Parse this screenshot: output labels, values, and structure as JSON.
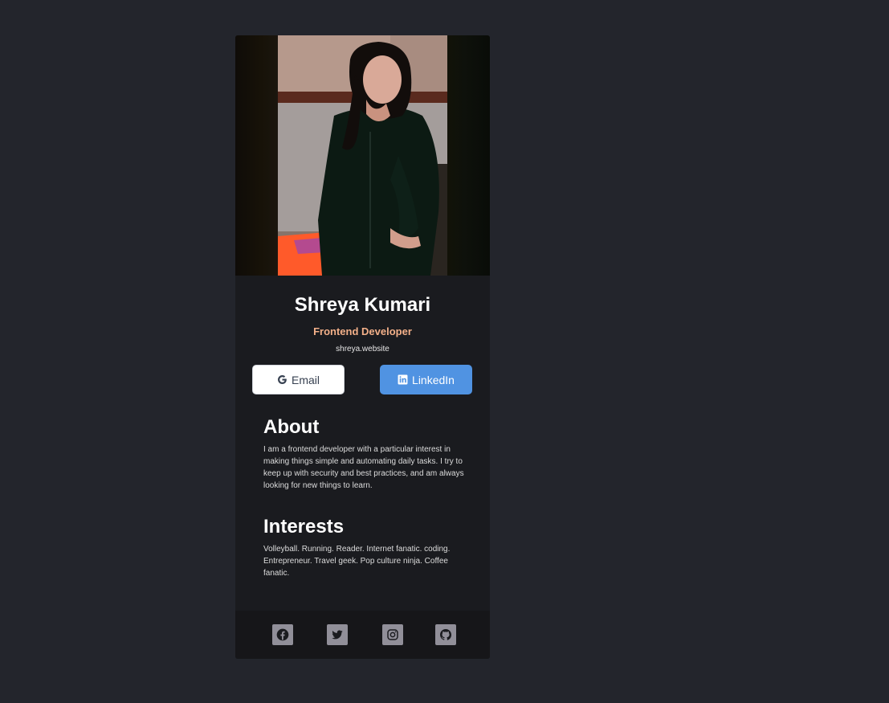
{
  "profile": {
    "name": "Shreya Kumari",
    "role": "Frontend Developer",
    "website": "shreya.website"
  },
  "buttons": {
    "email_label": "Email",
    "linkedin_label": "LinkedIn"
  },
  "about": {
    "title": "About",
    "text": "I am a frontend developer with a particular interest in making things simple and automating daily tasks. I try to keep up with security and best practices, and am always looking for new things to learn."
  },
  "interests": {
    "title": "Interests",
    "text": "Volleyball. Running. Reader. Internet fanatic. coding. Entrepreneur. Travel geek. Pop culture ninja. Coffee fanatic."
  },
  "social_icons": [
    "facebook-icon",
    "twitter-icon",
    "instagram-icon",
    "github-icon"
  ],
  "colors": {
    "page_background": "#23252c",
    "card_background": "#1a1b1f",
    "footer_background": "#161619",
    "role_accent": "#f3b089",
    "linkedin_button": "#5093e2",
    "social_icon_background": "#918f99"
  }
}
